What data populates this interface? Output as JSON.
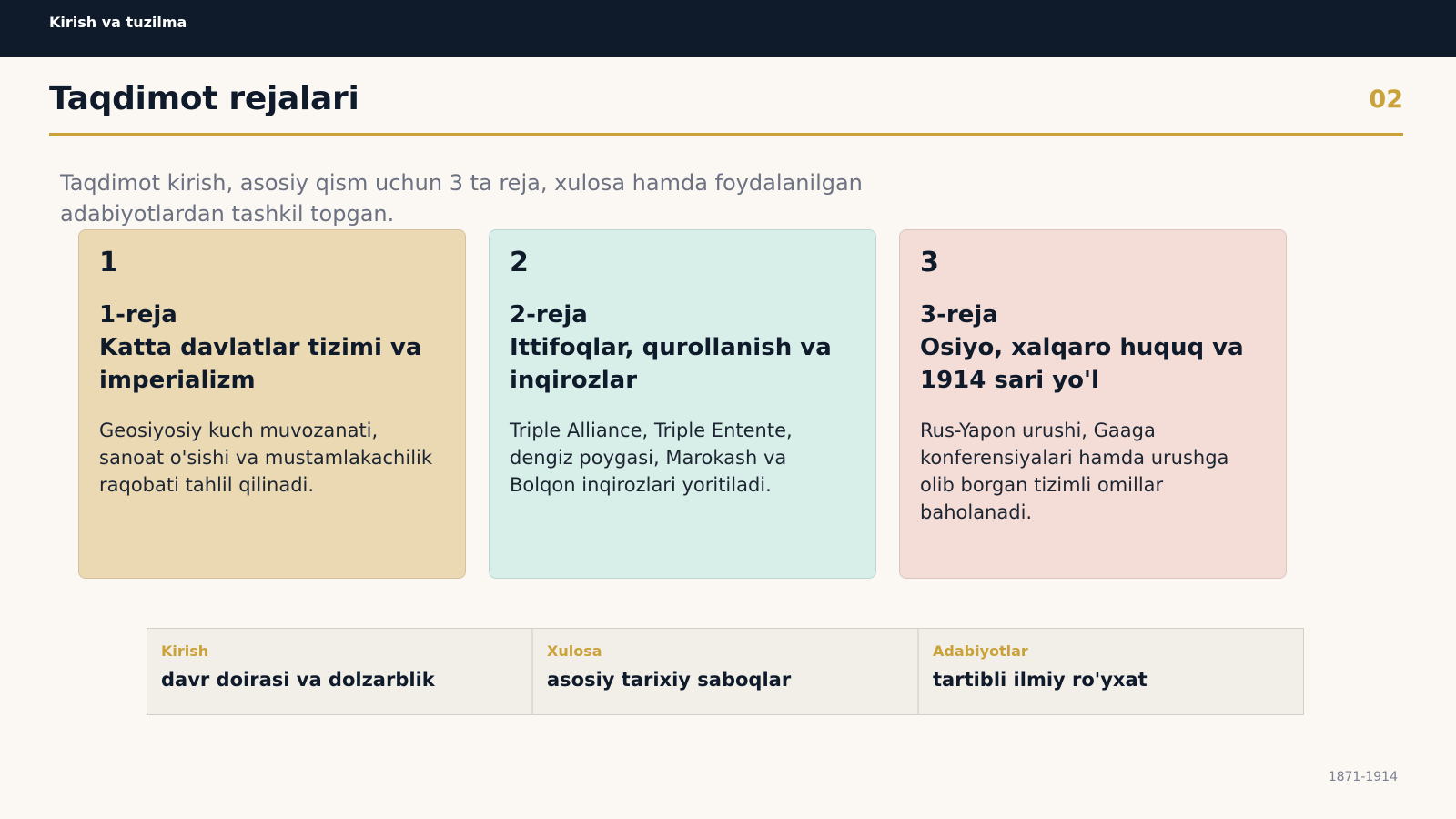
{
  "header": {
    "section_title": "Kirish va tuzilma"
  },
  "page": {
    "title": "Taqdimot rejalari",
    "number": "02"
  },
  "intro": "Taqdimot kirish, asosiy qism uchun 3 ta reja, xulosa hamda foydalanilgan adabiyotlardan tashkil topgan.",
  "cards": [
    {
      "number": "1",
      "title_line1": "1-reja",
      "title_line2": "Katta davlatlar tizimi va imperializm",
      "text": "Geosiyosiy kuch muvozanati, sanoat o'sishi va mustamlakachilik raqobati tahlil qilinadi.",
      "color": "#ead9b3"
    },
    {
      "number": "2",
      "title_line1": "2-reja",
      "title_line2": "Ittifoqlar, qurollanish va inqirozlar",
      "text": "Triple Alliance, Triple Entente, dengiz poygasi, Marokash va Bolqon inqirozlari yoritiladi.",
      "color": "#d8efe9"
    },
    {
      "number": "3",
      "title_line1": "3-reja",
      "title_line2": "Osiyo, xalqaro huquq va 1914 sari yo'l",
      "text": "Rus-Yapon urushi, Gaaga konferensiyalari hamda urushga olib borgan tizimli omillar baholanadi.",
      "color": "#f3ddd6"
    }
  ],
  "bottom_strip": [
    {
      "label": "Kirish",
      "value": "davr doirasi va dolzarblik"
    },
    {
      "label": "Xulosa",
      "value": "asosiy tarixiy saboqlar"
    },
    {
      "label": "Adabiyotlar",
      "value": "tartibli ilmiy ro'yxat"
    }
  ],
  "footer": {
    "years": "1871-1914"
  },
  "colors": {
    "accent": "#c9a23a",
    "navy": "#0f1a2b",
    "background": "#fbf8f4"
  }
}
